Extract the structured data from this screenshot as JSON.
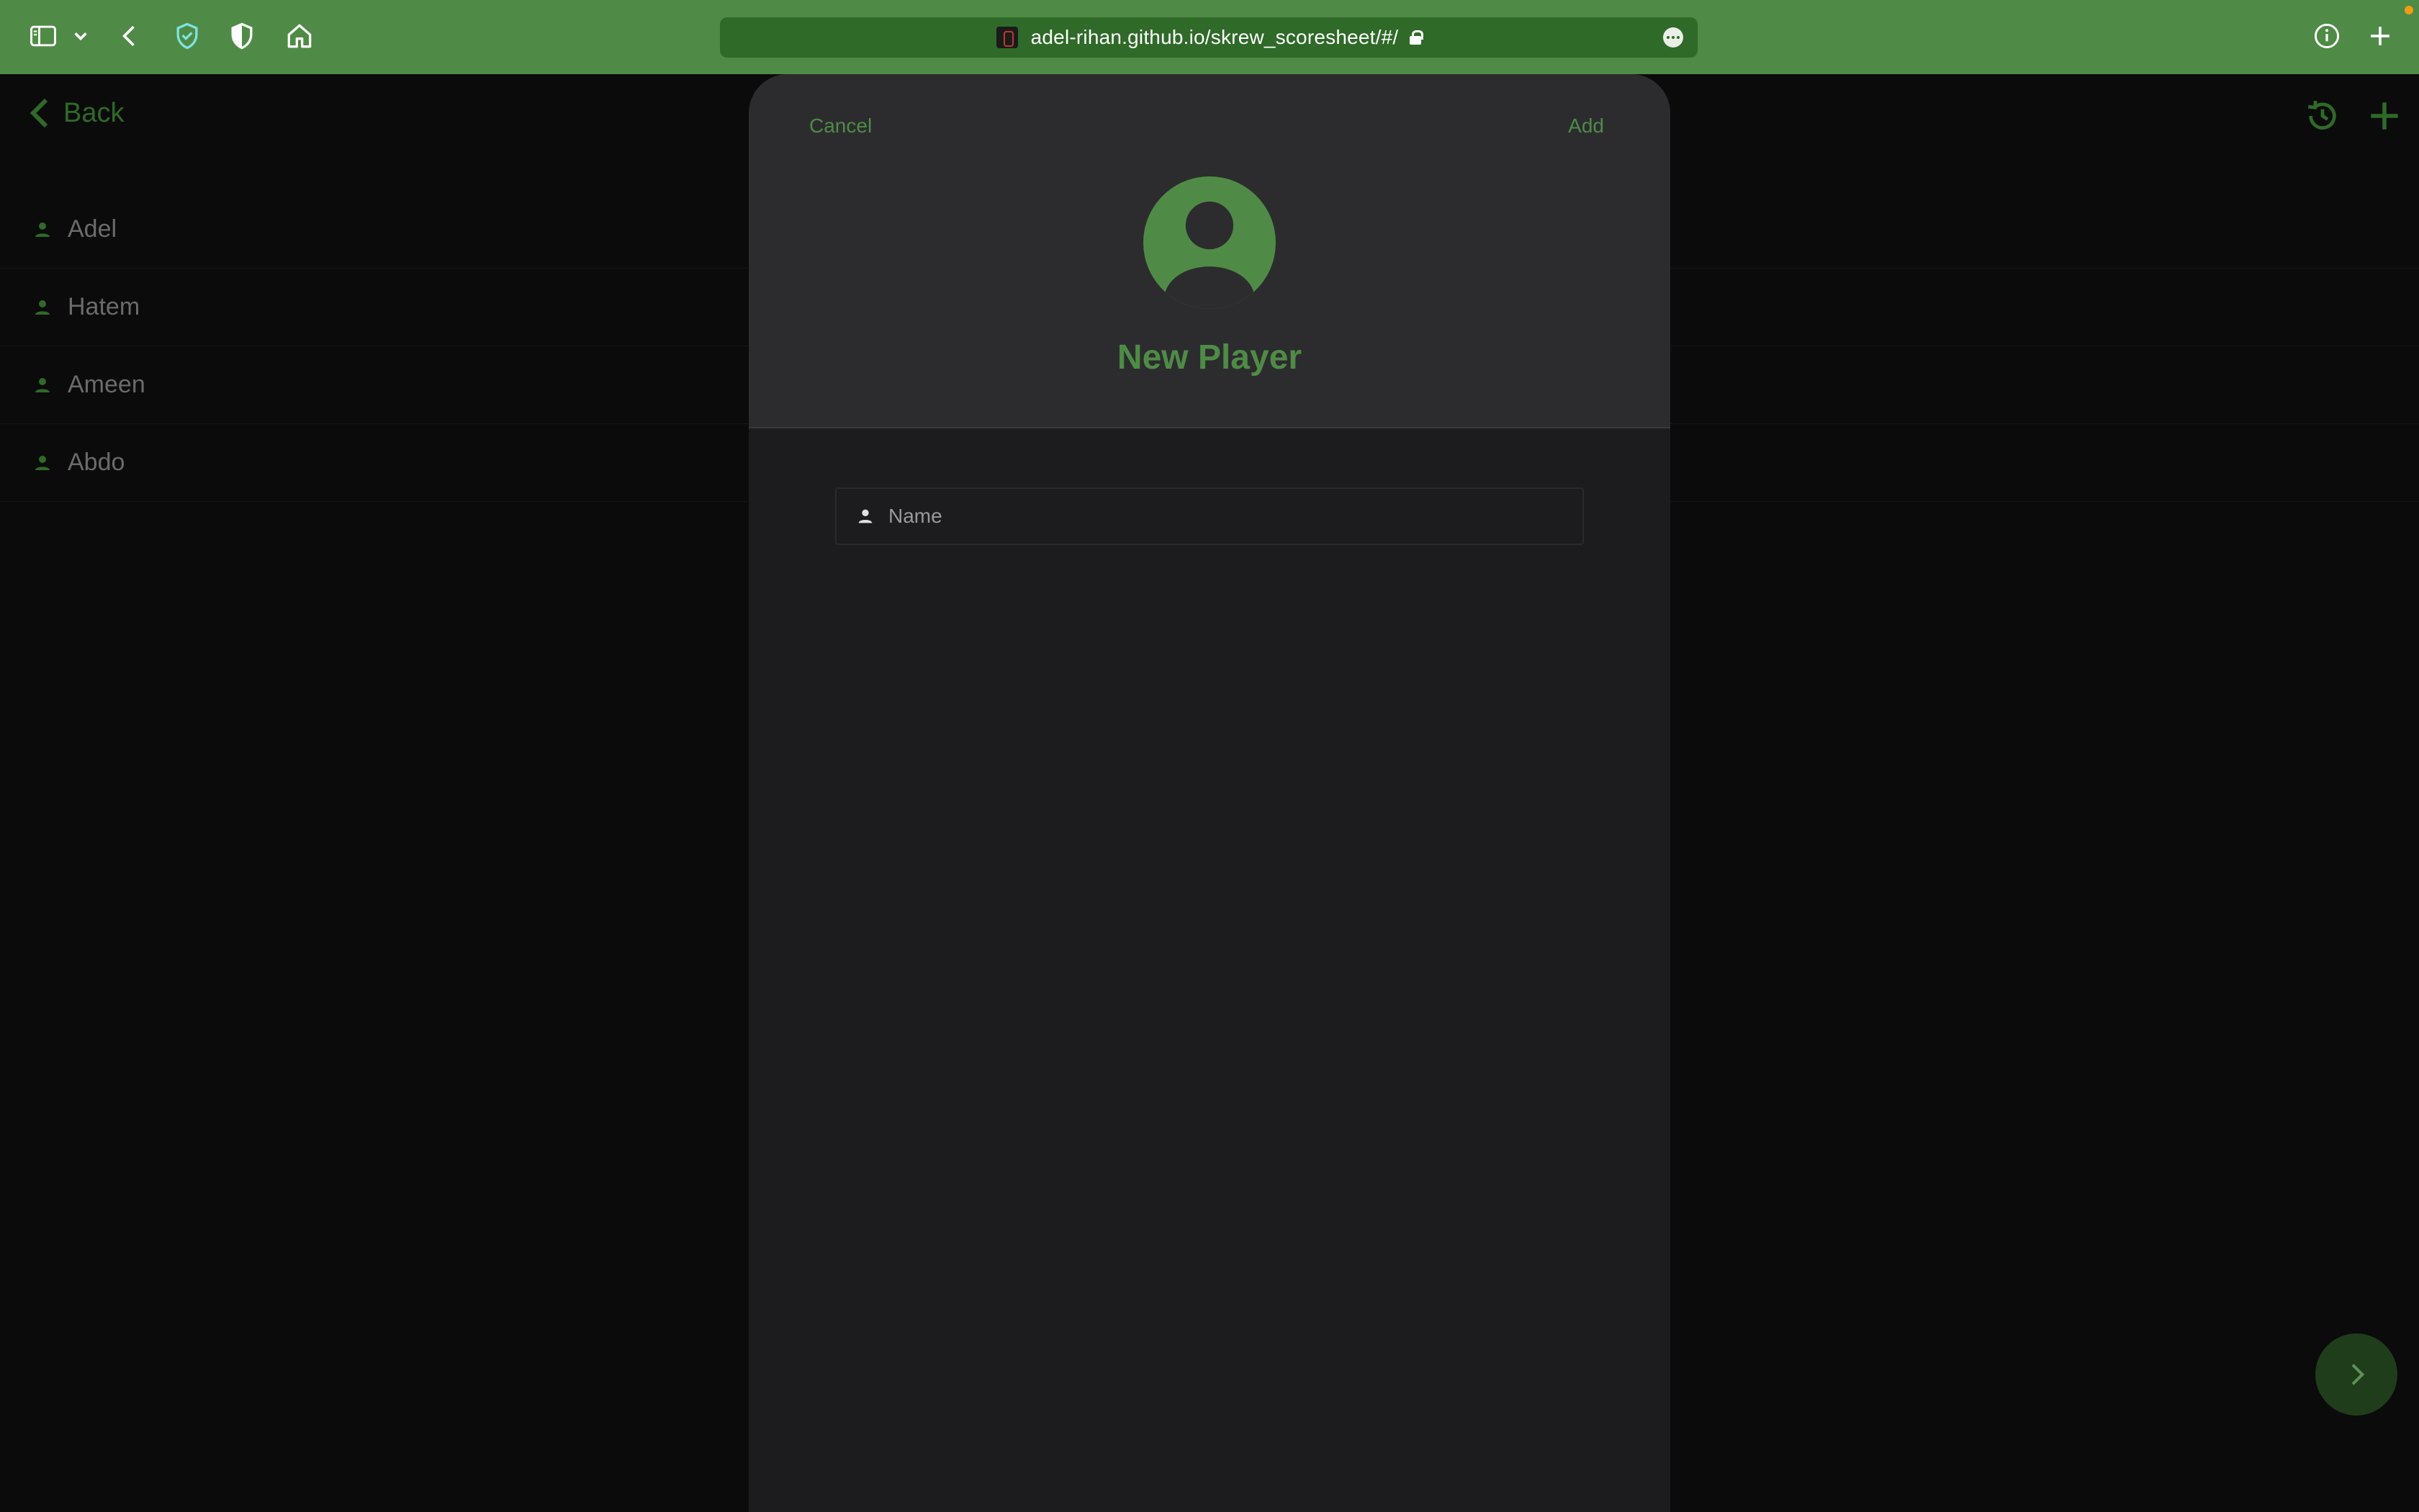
{
  "browser": {
    "url": "adel-rihan.github.io/skrew_scoresheet/#/",
    "colors": {
      "toolbar": "#4f8b46",
      "urlbar": "#2f6a28"
    }
  },
  "app": {
    "back_label": "Back",
    "players": [
      {
        "name": "Adel"
      },
      {
        "name": "Hatem"
      },
      {
        "name": "Ameen"
      },
      {
        "name": "Abdo"
      }
    ]
  },
  "modal": {
    "cancel_label": "Cancel",
    "add_label": "Add",
    "title": "New Player",
    "name_field": {
      "value": "",
      "placeholder": "Name"
    }
  },
  "colors": {
    "accent": "#4f8b46",
    "modal_bg": "#1c1c1e",
    "modal_header_bg": "#2c2c2e"
  }
}
